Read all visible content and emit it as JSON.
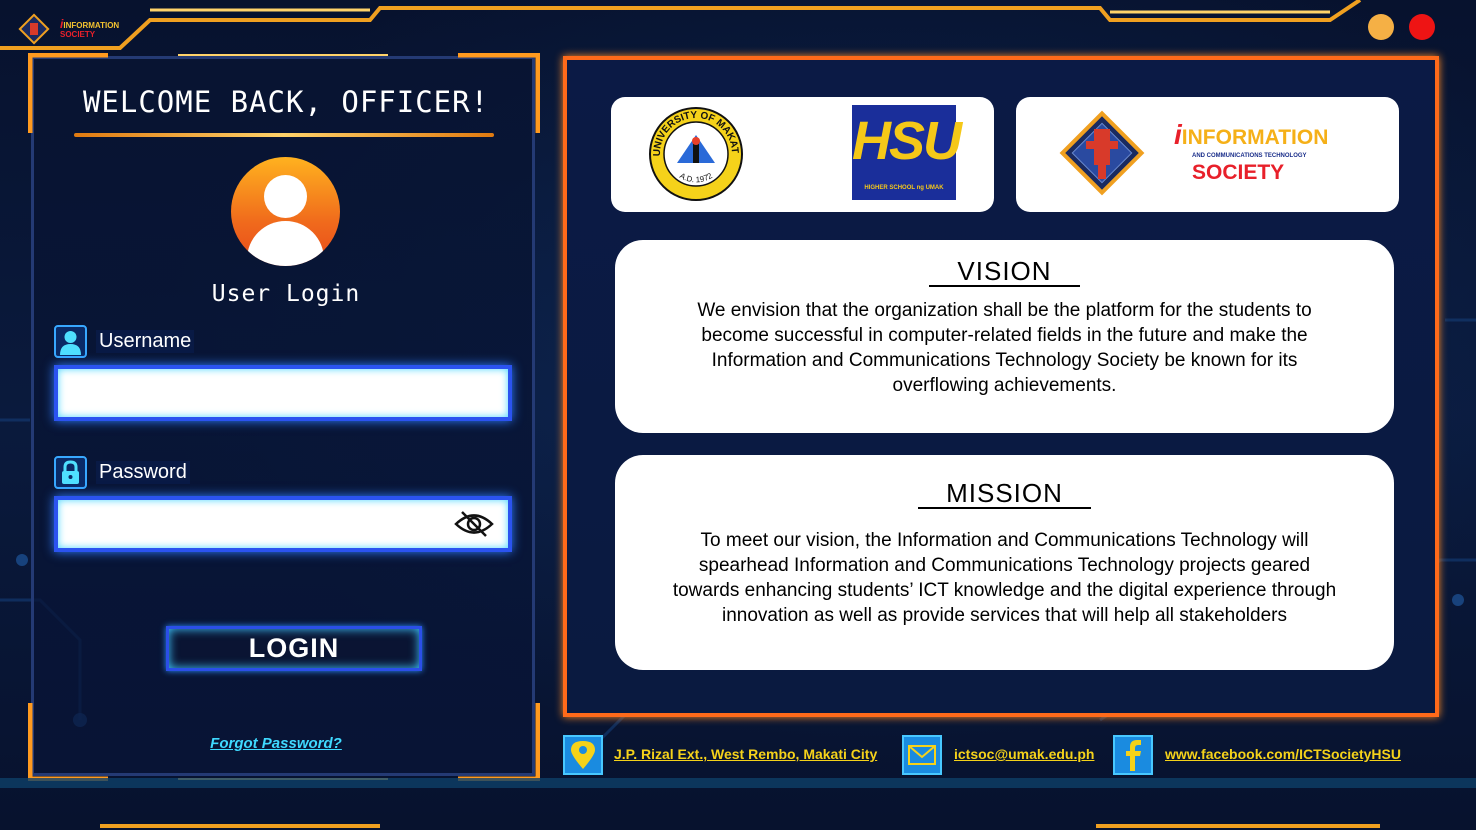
{
  "app": {
    "logo_name": "ict-society-logo-icon",
    "title_line1": "INFORMATION",
    "title_line2": "SOCIETY"
  },
  "window_controls": {
    "minimize_color": "#f5b045",
    "close_color": "#ee1414"
  },
  "login": {
    "heading": "WELCOME BACK, OFFICER!",
    "subheading": "User Login",
    "username_label": "Username",
    "username_value": "",
    "password_label": "Password",
    "password_value": "",
    "login_button": "LOGIN",
    "forgot_link": "Forgot Password?"
  },
  "logos": {
    "umak_ring": "UNIVERSITY OF MAKATI",
    "umak_year": "A.D. 1972",
    "hsu": "HSU",
    "hsu_caption": "HIGHER SCHOOL ng UMAK",
    "ict_line1": "INFORMATION",
    "ict_line2": "AND COMMUNICATIONS TECHNOLOGY",
    "ict_line3": "SOCIETY"
  },
  "vision": {
    "title": "VISION",
    "text": "We envision that the organization shall be the platform for the students to become successful in computer-related fields in the future and make the Information and Communications Technology Society be known for its overflowing achievements."
  },
  "mission": {
    "title": "MISSION",
    "text": "To meet our vision, the Information and Communications Technology will spearhead Information and Communications Technology projects geared towards enhancing students’ ICT knowledge and the digital experience through innovation as well as provide services that will help all stakeholders"
  },
  "footer": {
    "address": "J.P. Rizal Ext., West Rembo, Makati City",
    "email": "ictsoc@umak.edu.ph",
    "facebook": "www.facebook.com/ICTSocietyHSU",
    "icons": [
      "location-pin-icon",
      "mail-icon",
      "facebook-icon"
    ]
  },
  "colors": {
    "accent_orange": "#ff6a1a",
    "accent_blue": "#2b53f0",
    "link_yellow": "#f5d21a",
    "link_cyan": "#3fd9ff"
  }
}
